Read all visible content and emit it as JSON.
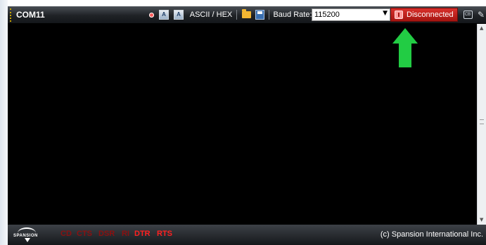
{
  "toolbar": {
    "port_name": "COM11",
    "icon_a1_label": "A",
    "icon_a2_label": "A",
    "ascii_hex_label": "ASCII / HEX",
    "baud_label": "Baud Rate:",
    "baud_value": "115200",
    "connection_status": "Disconnected",
    "small_icon_label": "CB"
  },
  "statusbar": {
    "logo_text": "SPANSION",
    "signals": [
      {
        "label": "CD",
        "active": false
      },
      {
        "label": "CTS",
        "active": false
      },
      {
        "label": "DSR",
        "active": false
      },
      {
        "label": "RI",
        "active": false
      },
      {
        "label": "DTR",
        "active": true
      },
      {
        "label": "RTS",
        "active": true
      }
    ],
    "copyright": "(c) Spansion International Inc."
  },
  "colors": {
    "accent_disconnected": "#c0201b",
    "signal_active": "#ff2020",
    "signal_inactive": "#8b1010",
    "annotation_arrow": "#22cc44",
    "terminal_bg": "#000000"
  }
}
